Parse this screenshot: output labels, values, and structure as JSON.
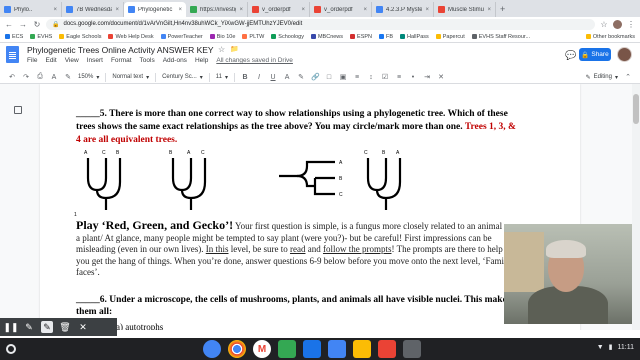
{
  "browser": {
    "tabs": [
      {
        "label": "Phylo..",
        "color": "#4285f4",
        "active": false
      },
      {
        "label": "7B Wednesday",
        "color": "#4285f4",
        "active": false
      },
      {
        "label": "Phylogenetic Tr...",
        "color": "#4285f4",
        "active": true
      },
      {
        "label": "https://investiga",
        "color": "#34a853",
        "active": false
      },
      {
        "label": "v_orderpdf",
        "color": "#ea4335",
        "active": false
      },
      {
        "label": "v_orderpdf",
        "color": "#ea4335",
        "active": false
      },
      {
        "label": "4.2.3.P Mystery",
        "color": "#4285f4",
        "active": false
      },
      {
        "label": "Muscle Stimulati",
        "color": "#ea4335",
        "active": false
      }
    ],
    "url": "docs.google.com/document/d/1vArVnGilt,Hn4nv38uhWCk_YiXwGW-jjEMTUhzYJEV0/edit",
    "bookmarks": [
      "ECS",
      "EVHS",
      "Eagle Schools",
      "Web Help Desk",
      "PowerTeacher",
      "Bio 10e",
      "PLTW",
      "Schoology",
      "MBCnews",
      "ESPN",
      "FB",
      "HallPass",
      "Papercut",
      "EVHS Staff Resour..."
    ],
    "other_bookmarks": "Other bookmarks"
  },
  "docs": {
    "title": "Phylogenetic Trees Online Activity ANSWER KEY",
    "menu": [
      "File",
      "Edit",
      "View",
      "Insert",
      "Format",
      "Tools",
      "Add-ons",
      "Help"
    ],
    "saved_status": "All changes saved in Drive",
    "share_label": "Share",
    "toolbar": {
      "zoom": "150%",
      "style": "Normal text",
      "font": "Century Sc...",
      "size": "11",
      "mode": "Editing"
    }
  },
  "content": {
    "q5_prefix": "_____5. There is more than one correct way to show relationships using a phylogenetic tree. Which of these trees shows the same exact relationships as the tree above? You may circle/mark more than one.",
    "q5_answer": "Trees 1, 3, & 4 are all equivalent trees.",
    "tree_number": "1",
    "trees": [
      {
        "labels": [
          "A",
          "C",
          "B"
        ]
      },
      {
        "labels": [
          "B",
          "A",
          "C"
        ]
      },
      {
        "labels": [
          "A",
          "B",
          "C"
        ]
      },
      {
        "labels": [
          "C",
          "B",
          "A"
        ]
      }
    ],
    "rgg_title": "Play ‘Red, Green, and Gecko’!",
    "rgg_text1": " Your first question is simple, is a fungus more closely related to an animal or a plant/ At glance, many people might be tempted to say plant (were you?)- but be careful! First impressions can be misleading (even in our own lives). ",
    "rgg_u1": "In this",
    "rgg_text2": " level, be sure to ",
    "rgg_u2": "read",
    "rgg_text3": " and ",
    "rgg_u3": "follow the prompts",
    "rgg_text4": "! The prompts are there to help you get the hang of things. When you’re done, answer questions 6-9 below before you move onto the next level, ‘Familiar faces’.",
    "q6": "_____6. Under a microscope, the cells of mushrooms, plants, and animals all have visible nuclei. This makes them all:",
    "q6_option": "a) autotrophs"
  },
  "system": {
    "time": "11:11"
  }
}
